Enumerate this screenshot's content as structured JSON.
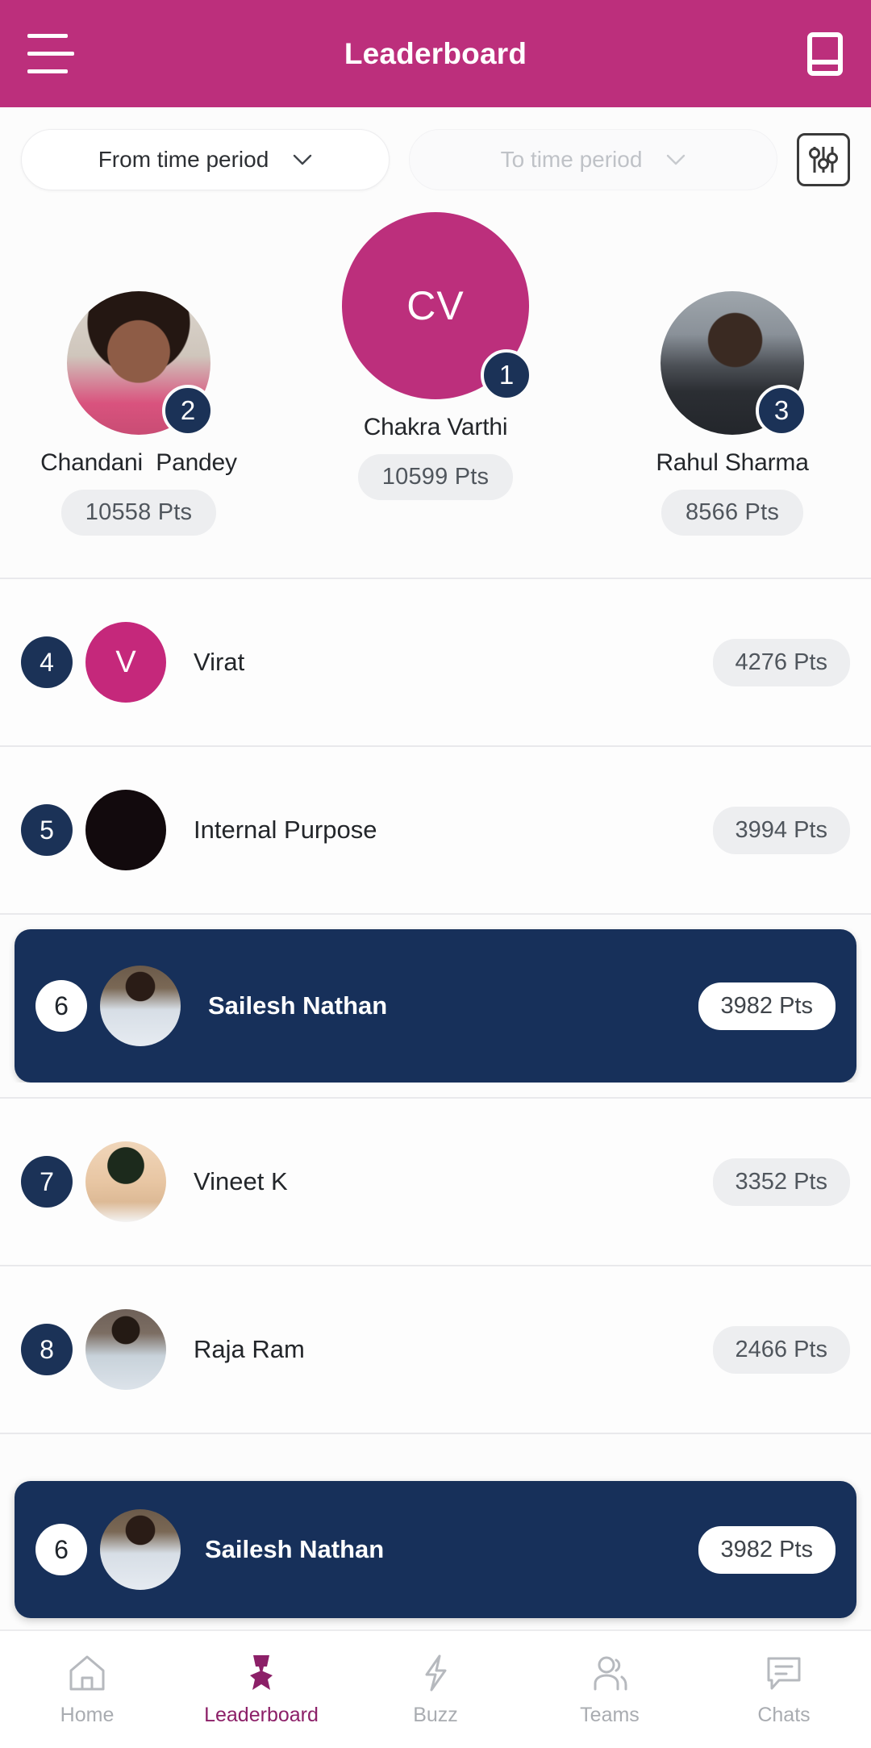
{
  "header": {
    "title": "Leaderboard",
    "menu_icon": "hamburger-menu-icon",
    "right_icon": "book-icon"
  },
  "filters": {
    "from": {
      "label": "From time period",
      "icon": "chevron-down-icon"
    },
    "to": {
      "label": "To time period",
      "icon": "chevron-down-icon"
    },
    "filter_button_icon": "sliders-filter-icon"
  },
  "podium": [
    {
      "rank": "2",
      "name": "Chandani  Pandey",
      "points": "10558 Pts",
      "avatar_type": "photo",
      "avatar_class": "ph-chandani",
      "initials": ""
    },
    {
      "rank": "1",
      "name": "Chakra Varthi",
      "points": "10599 Pts",
      "avatar_type": "initials",
      "avatar_class": "",
      "initials": "CV"
    },
    {
      "rank": "3",
      "name": "Rahul Sharma",
      "points": "8566 Pts",
      "avatar_type": "photo",
      "avatar_class": "ph-rahul",
      "initials": ""
    }
  ],
  "rows": [
    {
      "rank": "4",
      "name": "Virat",
      "points": "4276 Pts",
      "avatar_type": "initials",
      "avatar_class": "initial",
      "initials": "V",
      "highlight": false
    },
    {
      "rank": "5",
      "name": "Internal Purpose",
      "points": "3994 Pts",
      "avatar_type": "solid",
      "avatar_class": "solid-black",
      "initials": "",
      "highlight": false
    },
    {
      "rank": "6",
      "name": "Sailesh Nathan",
      "points": "3982 Pts",
      "avatar_type": "photo",
      "avatar_class": "ph-sailesh",
      "initials": "",
      "highlight": true
    },
    {
      "rank": "7",
      "name": "Vineet K",
      "points": "3352 Pts",
      "avatar_type": "photo",
      "avatar_class": "ph-vineet",
      "initials": "",
      "highlight": false
    },
    {
      "rank": "8",
      "name": "Raja Ram",
      "points": "2466 Pts",
      "avatar_type": "photo",
      "avatar_class": "ph-rajaram",
      "initials": "",
      "highlight": false
    }
  ],
  "self_rank": {
    "rank": "6",
    "name": "Sailesh Nathan",
    "points": "3982 Pts",
    "avatar_class": "ph-sailesh"
  },
  "bottom_nav": {
    "active": "Leaderboard",
    "items": [
      {
        "label": "Home",
        "icon": "home-icon"
      },
      {
        "label": "Leaderboard",
        "icon": "medal-icon"
      },
      {
        "label": "Buzz",
        "icon": "lightning-bolt-icon"
      },
      {
        "label": "Teams",
        "icon": "people-icon"
      },
      {
        "label": "Chats",
        "icon": "chat-bubble-icon"
      }
    ]
  },
  "colors": {
    "brand_magenta": "#BC2F7C",
    "navy": "#1B3257",
    "highlight_navy": "#17305A",
    "pill_gray": "#EDEEF0",
    "page_bg": "#FCFCFC",
    "nav_active": "#8C2068"
  }
}
